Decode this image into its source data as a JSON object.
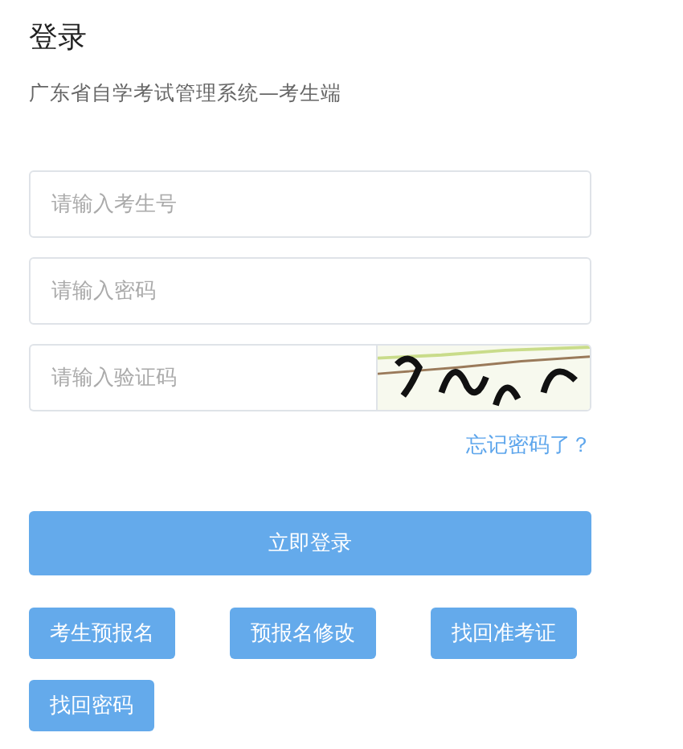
{
  "title": "登录",
  "subtitle": "广东省自学考试管理系统—考生端",
  "fields": [
    {
      "placeholder": "请输入考生号",
      "kind": "text"
    },
    {
      "placeholder": "请输入密码",
      "kind": "password"
    },
    {
      "placeholder": "请输入验证码",
      "kind": "captcha"
    }
  ],
  "forgot_link": "忘记密码了？",
  "login_button": "立即登录",
  "buttons": [
    "考生预报名",
    "预报名修改",
    "找回准考证",
    "找回密码"
  ]
}
